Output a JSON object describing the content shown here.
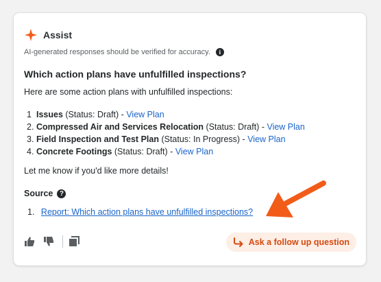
{
  "assist": {
    "title": "Assist",
    "disclaimer": "AI-generated responses should be verified for accuracy.",
    "question": "Which action plans have unfulfilled inspections?",
    "intro": "Here are some action plans with unfulfilled inspections:",
    "plans": [
      {
        "num": "1",
        "name": "Issues",
        "status": " (Status: Draft) - ",
        "link": "View Plan"
      },
      {
        "num": "2.",
        "name": "Compressed Air and Services Relocation",
        "status": " (Status: Draft) - ",
        "link": "View Plan"
      },
      {
        "num": "3.",
        "name": "Field Inspection and Test Plan",
        "status": " (Status: In Progress) - ",
        "link": "View Plan"
      },
      {
        "num": "4.",
        "name": "Concrete Footings",
        "status": " (Status: Draft) - ",
        "link": "View Plan"
      }
    ],
    "closing": "Let me know if you'd like more details!",
    "source_label": "Source",
    "sources": [
      {
        "num": "1.",
        "link": "Report: Which action plans have unfulfilled inspections?"
      }
    ],
    "followup_label": "Ask a follow up question",
    "icons": {
      "logo": "assist-sparkle-icon",
      "info": "info-icon",
      "help": "help-icon",
      "thumbs_up": "thumbs-up-icon",
      "thumbs_down": "thumbs-down-icon",
      "copy": "copy-icon",
      "reply": "reply-arrow-icon",
      "annotation": "orange-arrow-icon"
    },
    "colors": {
      "accent": "#f25c19",
      "link": "#1a64c8",
      "followup_bg": "#fdeee6",
      "followup_text": "#d44a0f"
    }
  }
}
